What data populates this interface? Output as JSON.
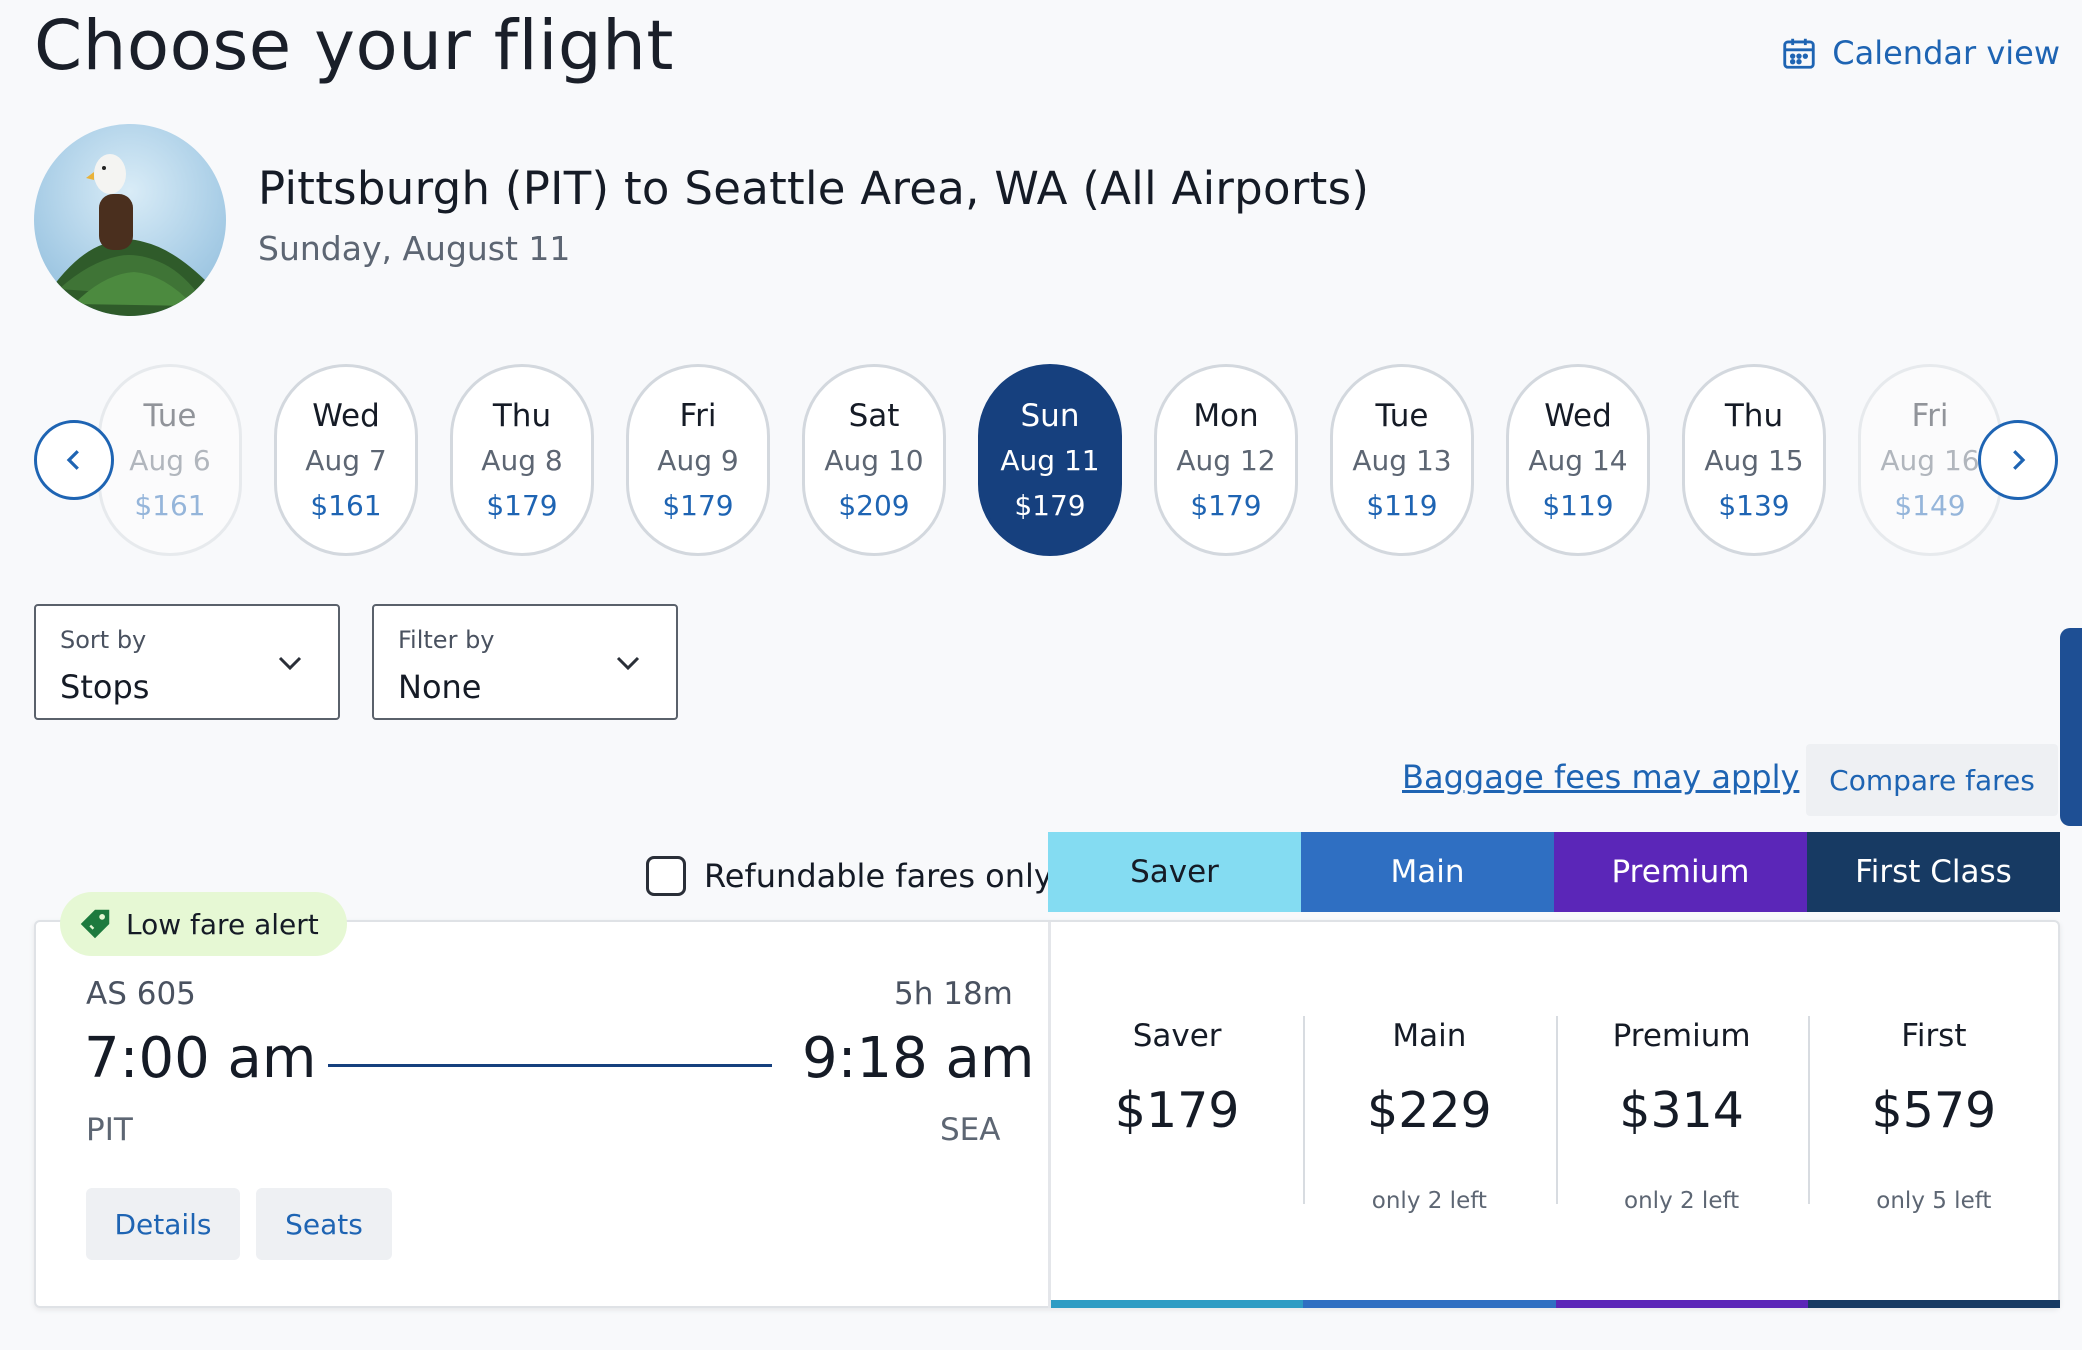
{
  "header": {
    "title": "Choose your flight",
    "calendar_view_label": "Calendar view"
  },
  "route": {
    "title": "Pittsburgh (PIT) to Seattle Area, WA (All Airports)",
    "date": "Sunday, August 11"
  },
  "date_strip": {
    "dates": [
      {
        "day": "Tue",
        "date": "Aug 6",
        "price": "$161",
        "state": "faded"
      },
      {
        "day": "Wed",
        "date": "Aug 7",
        "price": "$161",
        "state": "normal"
      },
      {
        "day": "Thu",
        "date": "Aug 8",
        "price": "$179",
        "state": "normal"
      },
      {
        "day": "Fri",
        "date": "Aug 9",
        "price": "$179",
        "state": "normal"
      },
      {
        "day": "Sat",
        "date": "Aug 10",
        "price": "$209",
        "state": "normal"
      },
      {
        "day": "Sun",
        "date": "Aug 11",
        "price": "$179",
        "state": "selected"
      },
      {
        "day": "Mon",
        "date": "Aug 12",
        "price": "$179",
        "state": "normal"
      },
      {
        "day": "Tue",
        "date": "Aug 13",
        "price": "$119",
        "state": "normal"
      },
      {
        "day": "Wed",
        "date": "Aug 14",
        "price": "$119",
        "state": "normal"
      },
      {
        "day": "Thu",
        "date": "Aug 15",
        "price": "$139",
        "state": "normal"
      },
      {
        "day": "Fri",
        "date": "Aug 16",
        "price": "$149",
        "state": "faded"
      }
    ]
  },
  "sort": {
    "label": "Sort by",
    "value": "Stops"
  },
  "filter": {
    "label": "Filter by",
    "value": "None"
  },
  "baggage_link": "Baggage fees may apply",
  "compare_fares": "Compare fares",
  "refundable_label": "Refundable fares only",
  "refundable_checked": false,
  "fare_classes": [
    {
      "label": "Saver",
      "bg": "#84dcf2",
      "fg": "#151b26",
      "bar": "#2e9cc4"
    },
    {
      "label": "Main",
      "bg": "#2f6fc2",
      "fg": "#ffffff",
      "bar": "#2f6fc2"
    },
    {
      "label": "Premium",
      "bg": "#5b26b8",
      "fg": "#ffffff",
      "bar": "#5b26b8"
    },
    {
      "label": "First Class",
      "bg": "#173a63",
      "fg": "#ffffff",
      "bar": "#173a63"
    }
  ],
  "flight": {
    "alert": "Low fare alert",
    "number": "AS 605",
    "duration": "5h 18m",
    "depart_time": "7:00 am",
    "arrive_time": "9:18 am",
    "depart_code": "PIT",
    "arrive_code": "SEA",
    "details_label": "Details",
    "seats_label": "Seats",
    "fares": [
      {
        "name": "Saver",
        "price": "$179",
        "seats": ""
      },
      {
        "name": "Main",
        "price": "$229",
        "seats": "only 2 left"
      },
      {
        "name": "Premium",
        "price": "$314",
        "seats": "only 2 left"
      },
      {
        "name": "First",
        "price": "$579",
        "seats": "only 5 left"
      }
    ]
  },
  "colors": {
    "accent": "#1e64b3",
    "selected_date": "#16407e",
    "alert_bg": "#e6f8d4"
  }
}
